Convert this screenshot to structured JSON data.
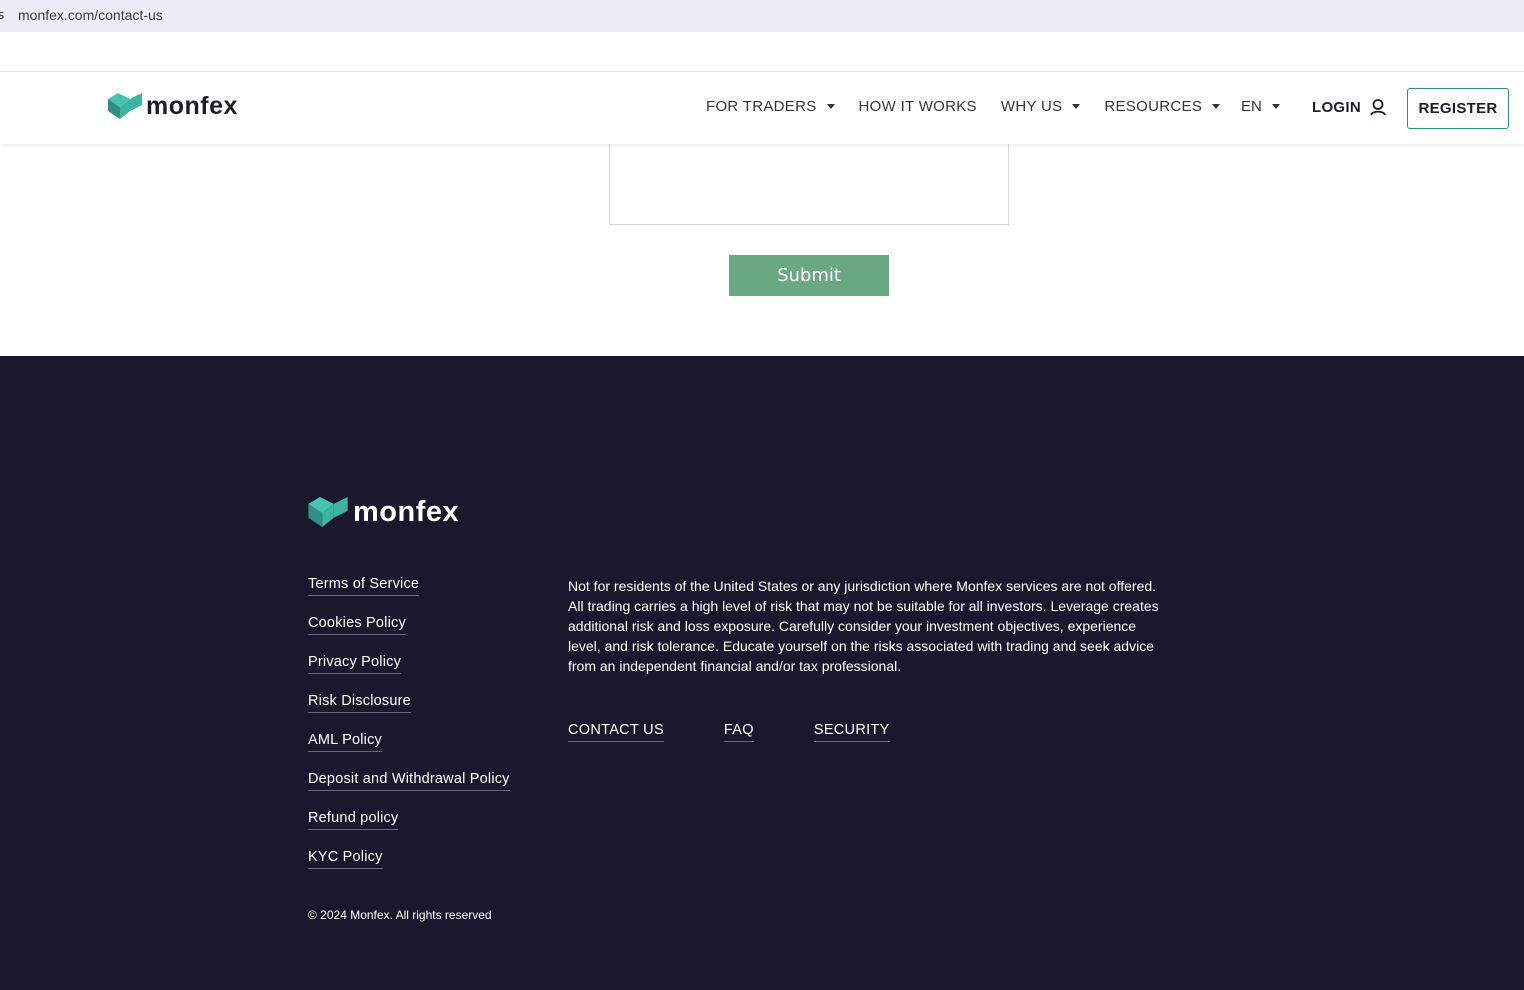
{
  "browser": {
    "url": "monfex.com/contact-us"
  },
  "brand": {
    "name": "monfex",
    "colors": {
      "teal": "#3bb4a3",
      "teal_dark": "#2e8f87",
      "dark_navy": "#1a182d",
      "submit_green": "#6aa884"
    }
  },
  "header": {
    "nav": [
      {
        "label": "FOR TRADERS",
        "has_dropdown": true
      },
      {
        "label": "HOW IT WORKS",
        "has_dropdown": false
      },
      {
        "label": "WHY US",
        "has_dropdown": true
      },
      {
        "label": "RESOURCES",
        "has_dropdown": true
      }
    ],
    "language": "EN",
    "login_label": "LOGIN",
    "login_icon": "user-icon",
    "register_label": "REGISTER"
  },
  "form": {
    "message_value": "",
    "submit_label": "Submit"
  },
  "footer": {
    "policies": [
      "Terms of Service",
      "Cookies Policy",
      "Privacy Policy",
      "Risk Disclosure",
      "AML Policy",
      "Deposit and Withdrawal Policy",
      "Refund policy",
      "KYC Policy"
    ],
    "disclaimer": "Not for residents of the United States or any jurisdiction where Monfex services are not offered. All trading carries a high level of risk that may not be suitable for all investors. Leverage creates additional risk and loss exposure. Carefully consider your investment objectives, experience level, and risk tolerance. Educate yourself on the risks associated with trading and seek advice from an independent financial and/or tax professional.",
    "links": [
      "CONTACT US",
      "FAQ",
      "SECURITY"
    ],
    "copyright": "© 2024 Monfex. All rights reserved"
  }
}
